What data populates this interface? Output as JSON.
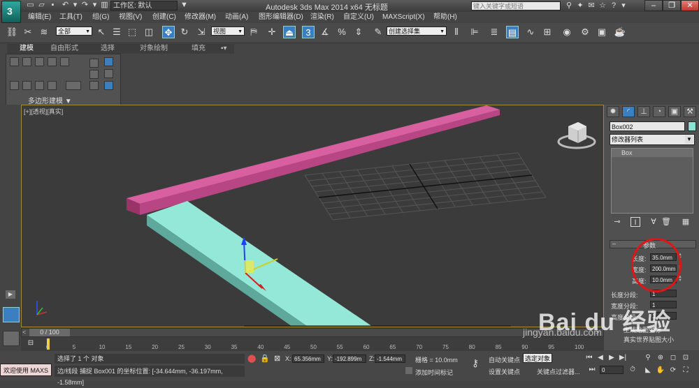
{
  "window": {
    "title": "Autodesk 3ds Max  2014 x64     无标题",
    "workspace_label": "工作区: 默认",
    "search_placeholder": "键入关键字或短语"
  },
  "menu": [
    "编辑(E)",
    "工具(T)",
    "组(G)",
    "视图(V)",
    "创建(C)",
    "修改器(M)",
    "动画(A)",
    "图形编辑器(D)",
    "渲染(R)",
    "自定义(U)",
    "MAXScript(X)",
    "帮助(H)"
  ],
  "toolbar": {
    "selection_filter": "全部",
    "ref_coord": "视图",
    "named_selection": "创建选择集"
  },
  "ribbon": {
    "tabs": [
      "建模",
      "自由形式",
      "选择",
      "对象绘制",
      "填充"
    ],
    "panel_label": "多边形建模 ▼"
  },
  "viewport": {
    "label": "[+][透视][真实]"
  },
  "command_panel": {
    "object_name": "Box002",
    "modifier_list": "修改器列表",
    "stack_item": "Box",
    "rollout_title": "参数",
    "params": [
      {
        "label": "长度:",
        "value": "35.0mm"
      },
      {
        "label": "宽度:",
        "value": "200.0mm"
      },
      {
        "label": "高度:",
        "value": "10.0mm"
      }
    ],
    "segments": [
      {
        "label": "长度分段:",
        "value": "1"
      },
      {
        "label": "宽度分段:",
        "value": "1"
      },
      {
        "label": "高度分段:",
        "value": "1"
      }
    ],
    "extra1": "生成贴图坐标",
    "extra2": "真实世界贴图大小"
  },
  "timeline": {
    "frame_display": "0 / 100",
    "ticks": [
      "0",
      "5",
      "10",
      "15",
      "20",
      "25",
      "30",
      "35",
      "40",
      "45",
      "50",
      "55",
      "60",
      "65",
      "70",
      "75",
      "80",
      "85",
      "90",
      "95",
      "100"
    ]
  },
  "status": {
    "welcome": "欢迎使用 MAXS",
    "line1": "选择了 1 个 对象",
    "line2": "边/线段 捕捉 Box001 的坐标位置: [-34.644mm, -36.197mm, -1.58mm]",
    "x_label": "X:",
    "x_value": "65.356mm",
    "y_label": "Y:",
    "y_value": "-192.899m",
    "z_label": "Z:",
    "z_value": "-1.544mm",
    "grid": "栅格 = 10.0mm",
    "add_time_tag": "添加时间标记",
    "auto_key": "自动关键点",
    "set_key": "设置关键点",
    "selected": "选定对象",
    "key_filters": "关键点过滤器...",
    "frame_field": "0"
  },
  "watermark": {
    "text": "Bai du 经验",
    "url": "jingyan.baidu.com"
  },
  "colors": {
    "pink_box": "#c84a8e",
    "cyan_box": "#8fe0d0",
    "annotation_circle": "#e01515",
    "viewport_bg": "#3b3b3b"
  }
}
